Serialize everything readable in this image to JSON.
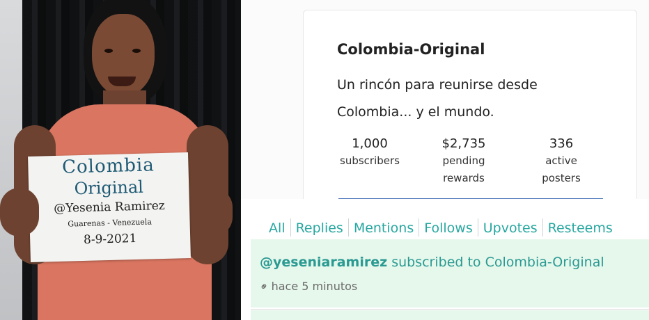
{
  "photo": {
    "sign_line1": "Colombia",
    "sign_line2": "Original",
    "sign_line3": "@Yesenia Ramirez",
    "sign_line4": "Guarenas - Venezuela",
    "sign_line5": "8-9-2021"
  },
  "community": {
    "title": "Colombia-Original",
    "description": "Un rincón para reunirse desde Colombia... y el mundo.",
    "stats": [
      {
        "value": "1,000",
        "label_1": "subscribers",
        "label_2": ""
      },
      {
        "value": "$2,735",
        "label_1": "pending",
        "label_2": "rewards"
      },
      {
        "value": "336",
        "label_1": "active",
        "label_2": "posters"
      }
    ]
  },
  "tabs": [
    "All",
    "Replies",
    "Mentions",
    "Follows",
    "Upvotes",
    "Resteems"
  ],
  "notification": {
    "user": "@yeseniaramirez",
    "action": " subscribed to Colombia-Original",
    "time": "hace 5 minutos",
    "icon": "link-icon"
  },
  "colors": {
    "accent": "#27a7a0",
    "notification_bg": "#e6f7ec",
    "underline": "#4a74b8"
  }
}
